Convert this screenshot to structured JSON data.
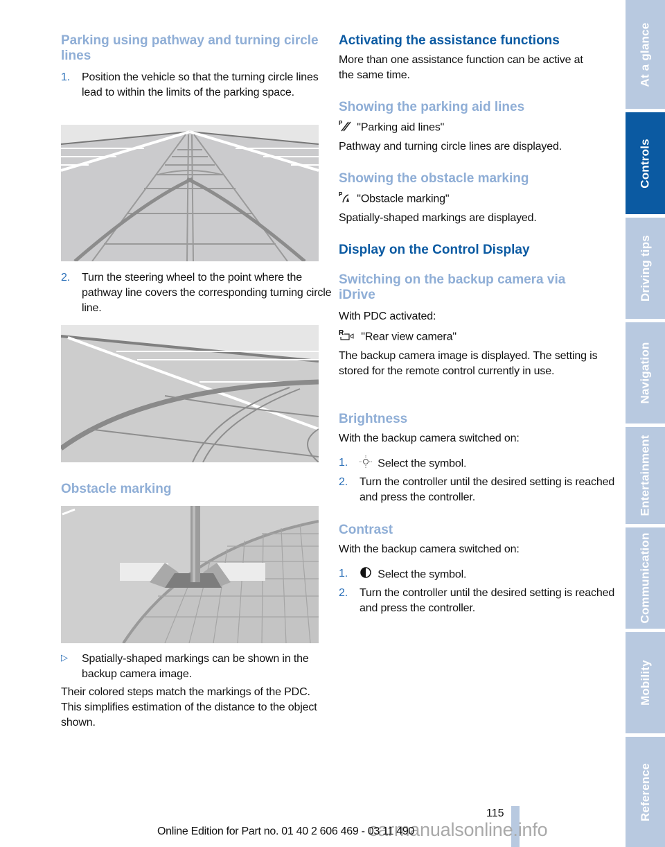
{
  "left_column": {
    "section_title": "Parking using pathway and turning circle lines",
    "step1_num": "1.",
    "step1_text": "Position the vehicle so that the turning circle lines lead to within the limits of the parking space.",
    "step2_num": "2.",
    "step2_text": "Turn the steering wheel to the point where the pathway line covers the corresponding turning circle line.",
    "obstacle_title": "Obstacle marking",
    "bullet_icon": "triangle-bullet-icon",
    "bullet_text": "Spatially-shaped markings can be shown in the backup camera image.",
    "closing_text": "Their colored steps match the markings of the PDC. This simplifies estimation of the distance to the object shown.",
    "figures": [
      {
        "name": "pathway-turning-lines-figure",
        "description": "Camera view with pathway and turning circle lines"
      },
      {
        "name": "steering-aligned-figure",
        "description": "Camera view with pathway line covering turning circle line"
      },
      {
        "name": "obstacle-marking-figure",
        "description": "Camera view with post and spatial obstacle marking"
      }
    ]
  },
  "right_column": {
    "main_title": "Activating the assistance functions",
    "intro": "More than one assistance function can be active at the same time.",
    "parking_aid": {
      "title": "Showing the parking aid lines",
      "icon": "parking-aid-lines-icon",
      "menu_item": "\"Parking aid lines\"",
      "desc": "Pathway and turning circle lines are displayed."
    },
    "obstacle": {
      "title": "Showing the obstacle marking",
      "icon": "obstacle-marking-icon",
      "menu_item": "\"Obstacle marking\"",
      "desc": "Spatially-shaped markings are displayed."
    },
    "display_title": "Display on the Control Display",
    "switching": {
      "title": "Switching on the backup camera via iDrive",
      "condition": "With PDC activated:",
      "icon": "rear-view-camera-icon",
      "menu_item": "\"Rear view camera\"",
      "desc": "The backup camera image is displayed. The setting is stored for the remote control currently in use."
    },
    "brightness": {
      "title": "Brightness",
      "condition": "With the backup camera switched on:",
      "step1_num": "1.",
      "step1_icon": "brightness-sun-icon",
      "step1_text": "Select the symbol.",
      "step2_num": "2.",
      "step2_text": "Turn the controller until the desired setting is reached and press the controller."
    },
    "contrast": {
      "title": "Contrast",
      "condition": "With the backup camera switched on:",
      "step1_num": "1.",
      "step1_icon": "contrast-half-circle-icon",
      "step1_text": "Select the symbol.",
      "step2_num": "2.",
      "step2_text": "Turn the controller until the desired setting is reached and press the controller."
    }
  },
  "side_tabs": [
    {
      "label": "At a glance",
      "active": false
    },
    {
      "label": "Controls",
      "active": true
    },
    {
      "label": "Driving tips",
      "active": false
    },
    {
      "label": "Navigation",
      "active": false
    },
    {
      "label": "Entertainment",
      "active": false
    },
    {
      "label": "Communication",
      "active": false
    },
    {
      "label": "Mobility",
      "active": false
    },
    {
      "label": "Reference",
      "active": false
    }
  ],
  "footer": {
    "page_number": "115",
    "edition": "Online Edition for Part no. 01 40 2 606 469 - 03 11 490",
    "watermark": "carmanualsonline.info"
  },
  "colors": {
    "heading_light": "#8faed6",
    "heading_dark": "#0b5aa2",
    "tab_inactive": "#b8c9e0",
    "tab_active": "#0b5aa2"
  }
}
